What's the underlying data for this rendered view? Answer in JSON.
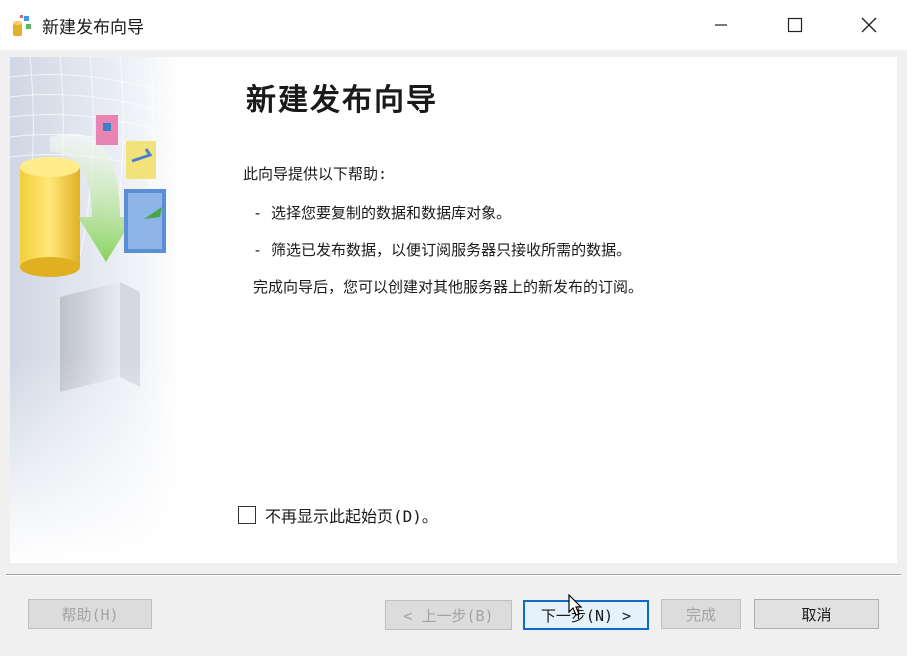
{
  "window": {
    "title": "新建发布向导",
    "controls": {
      "minimize": "—",
      "maximize": "☐",
      "close": "✕"
    }
  },
  "page": {
    "heading": "新建发布向导",
    "intro": "此向导提供以下帮助:",
    "bullet1": "-  选择您要复制的数据和数据库对象。",
    "bullet2": "-  筛选已发布数据，以便订阅服务器只接收所需的数据。",
    "closing": "完成向导后，您可以创建对其他服务器上的新发布的订阅。",
    "checkbox_label": "不再显示此起始页(D)。",
    "checkbox_checked": false
  },
  "buttons": {
    "help": "帮助(H)",
    "back": "< 上一步(B)",
    "next": "下一步(N) >",
    "finish": "完成",
    "cancel": "取消"
  },
  "icons": {
    "app": "publication-wizard-icon",
    "banner": "database-publish-illustration"
  },
  "colors": {
    "accent": "#0a6cc6",
    "disabled_text": "#a3a3a3"
  }
}
